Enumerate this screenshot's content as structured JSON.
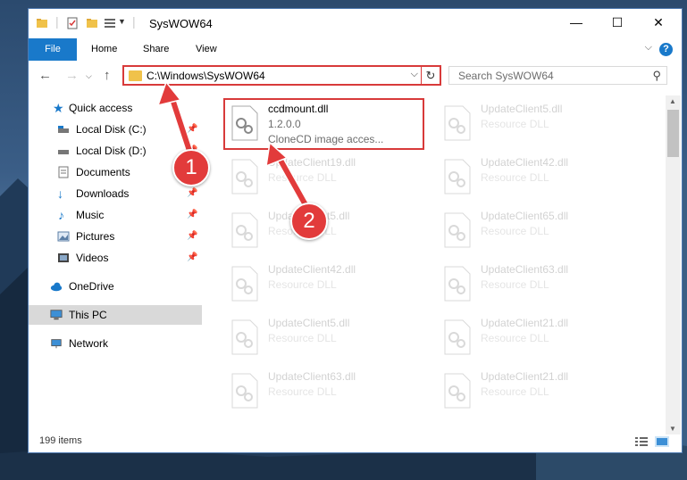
{
  "window": {
    "title": "SysWOW64",
    "minimize": "—",
    "maximize": "☐",
    "close": "✕"
  },
  "ribbon": {
    "file": "File",
    "home": "Home",
    "share": "Share",
    "view": "View",
    "help": "?"
  },
  "nav": {
    "address": "C:\\Windows\\SysWOW64",
    "search_placeholder": "Search SysWOW64"
  },
  "sidebar": {
    "items": [
      {
        "label": "Quick access",
        "icon": "star-icon",
        "pinned": false
      },
      {
        "label": "Local Disk (C:)",
        "icon": "drive-icon",
        "pinned": true
      },
      {
        "label": "Local Disk (D:)",
        "icon": "drive-icon",
        "pinned": true
      },
      {
        "label": "Documents",
        "icon": "documents-icon",
        "pinned": true
      },
      {
        "label": "Downloads",
        "icon": "download-icon",
        "pinned": true
      },
      {
        "label": "Music",
        "icon": "music-icon",
        "pinned": true
      },
      {
        "label": "Pictures",
        "icon": "pictures-icon",
        "pinned": true
      },
      {
        "label": "Videos",
        "icon": "videos-icon",
        "pinned": true
      },
      {
        "label": "OneDrive",
        "icon": "cloud-icon",
        "pinned": false
      },
      {
        "label": "This PC",
        "icon": "computer-icon",
        "pinned": false
      },
      {
        "label": "Network",
        "icon": "network-icon",
        "pinned": false
      }
    ]
  },
  "files": [
    {
      "name": "ccdmount.dll",
      "version": "1.2.0.0",
      "desc": "CloneCD image acces..."
    },
    {
      "name": "UpdateClient5.dll",
      "desc": "Resource DLL"
    },
    {
      "name": "UpdateClient19.dll",
      "desc": "Resource DLL"
    },
    {
      "name": "UpdateClient42.dll",
      "desc": "Resource DLL"
    },
    {
      "name": "UpdateClient5.dll",
      "desc": "Resource DLL"
    },
    {
      "name": "UpdateClient65.dll",
      "desc": "Resource DLL"
    },
    {
      "name": "UpdateClient42.dll",
      "desc": "Resource DLL"
    },
    {
      "name": "UpdateClient63.dll",
      "desc": "Resource DLL"
    },
    {
      "name": "UpdateClient5.dll",
      "desc": "Resource DLL"
    },
    {
      "name": "UpdateClient21.dll",
      "desc": "Resource DLL"
    },
    {
      "name": "UpdateClient63.dll",
      "desc": "Resource DLL"
    },
    {
      "name": "UpdateClient21.dll",
      "desc": "Resource DLL"
    }
  ],
  "status": {
    "item_count": "199 items"
  },
  "callouts": [
    "1",
    "2"
  ],
  "colors": {
    "accent": "#1979ca",
    "highlight": "#d83a3a",
    "callout": "#e23b3b"
  }
}
